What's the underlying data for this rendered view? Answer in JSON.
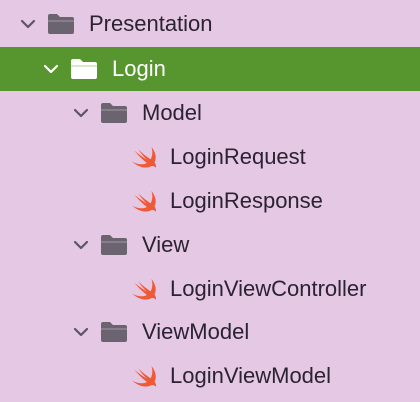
{
  "colors": {
    "background": "#e4c8e4",
    "selection": "#57952f",
    "folder": "#6b6470",
    "swift": "#ef5a36",
    "text": "#2b2233"
  },
  "tree": {
    "presentation": {
      "label": "Presentation",
      "icon": "folder-icon",
      "expanded": true
    },
    "login": {
      "label": "Login",
      "icon": "folder-icon",
      "expanded": true,
      "selected": true
    },
    "model": {
      "label": "Model",
      "icon": "folder-icon",
      "expanded": true
    },
    "login_request": {
      "label": "LoginRequest",
      "icon": "swift-file-icon"
    },
    "login_response": {
      "label": "LoginResponse",
      "icon": "swift-file-icon"
    },
    "view": {
      "label": "View",
      "icon": "folder-icon",
      "expanded": true
    },
    "login_view_controller": {
      "label": "LoginViewController",
      "icon": "swift-file-icon"
    },
    "view_model": {
      "label": "ViewModel",
      "icon": "folder-icon",
      "expanded": true
    },
    "login_view_model": {
      "label": "LoginViewModel",
      "icon": "swift-file-icon"
    }
  }
}
